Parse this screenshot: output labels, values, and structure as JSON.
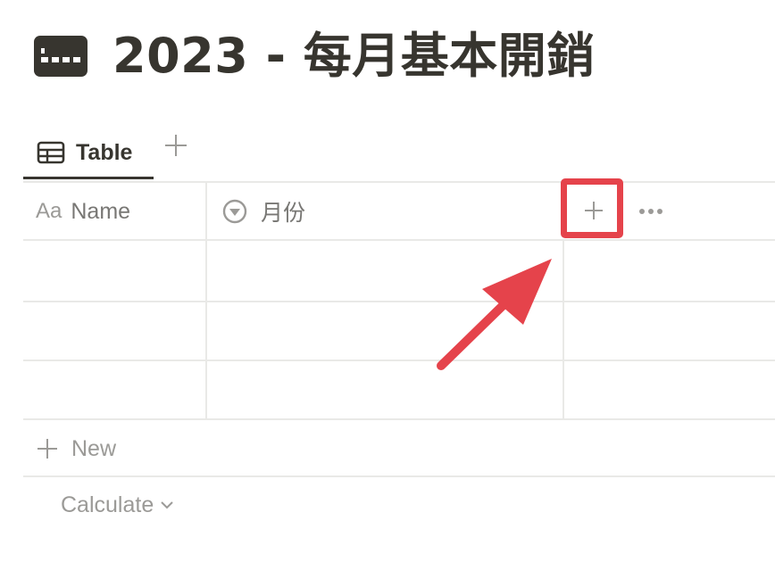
{
  "page": {
    "title": "2023 - 每月基本開銷",
    "icon": "credit-card-icon"
  },
  "views": {
    "tabs": [
      {
        "label": "Table",
        "icon": "table-icon"
      }
    ],
    "add_icon": "plus-icon"
  },
  "table": {
    "columns": [
      {
        "label": "Name",
        "type_label": "Aa"
      },
      {
        "label": "月份",
        "icon": "select-icon"
      }
    ],
    "rows": [
      {
        "name": "",
        "month": ""
      },
      {
        "name": "",
        "month": ""
      },
      {
        "name": "",
        "month": ""
      }
    ],
    "new_row_label": "New",
    "calculate_label": "Calculate"
  },
  "annotation": {
    "color": "#e5434b"
  }
}
